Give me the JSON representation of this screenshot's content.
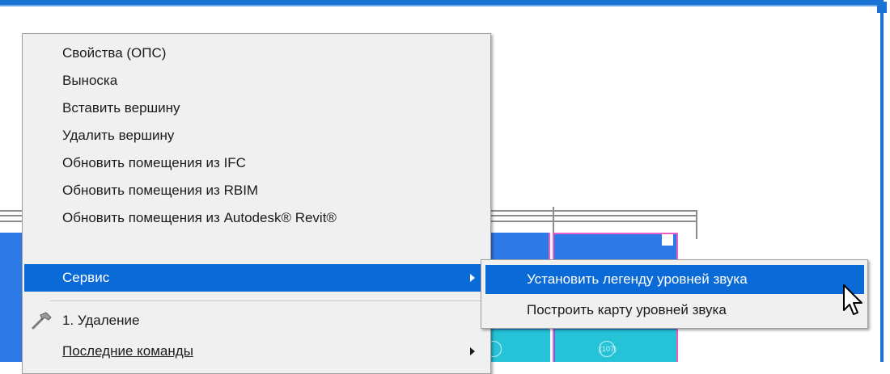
{
  "context_menu": {
    "items": [
      {
        "label": "Свойства (ОПС)"
      },
      {
        "label": "Выноска"
      },
      {
        "label": "Вставить вершину"
      },
      {
        "label": "Удалить вершину"
      },
      {
        "label": "Обновить помещения из IFC"
      },
      {
        "label": "Обновить помещения из RBIM"
      },
      {
        "label": "Обновить помещения из Autodesk® Revit®"
      },
      {
        "label": "Сервис",
        "has_submenu": true,
        "highlighted": true
      },
      {
        "label": "1. Удаление",
        "icon": "hammer-icon"
      },
      {
        "label": "Последние команды",
        "has_submenu": true
      }
    ]
  },
  "submenu": {
    "items": [
      {
        "label": "Установить легенду уровней звука",
        "highlighted": true
      },
      {
        "label": "Построить карту уровней звука"
      }
    ]
  },
  "canvas": {
    "room_tags": [
      "(107)"
    ],
    "colors": {
      "highlight": "#0a6ad8",
      "border_blue": "#1a73d4",
      "room_blue": "#2d79e6",
      "room_cyan": "#25c2d8",
      "room_edge": "#e85fc7"
    }
  }
}
